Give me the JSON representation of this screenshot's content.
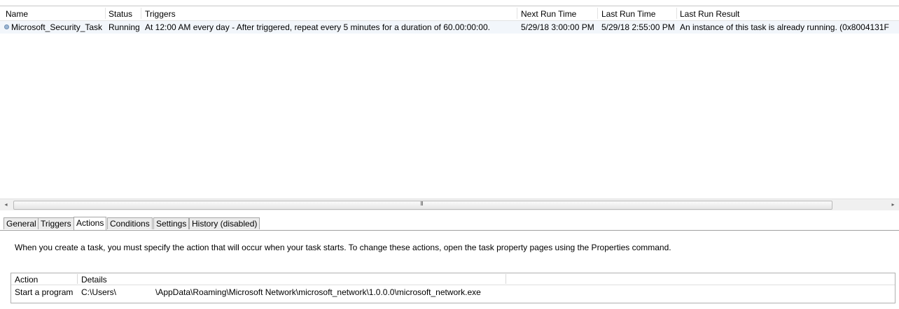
{
  "task_list": {
    "columns": [
      "Name",
      "Status",
      "Triggers",
      "Next Run Time",
      "Last Run Time",
      "Last Run Result"
    ],
    "rows": [
      {
        "name": "Microsoft_Security_Task",
        "status": "Running",
        "triggers": "At 12:00 AM every day - After triggered, repeat every 5 minutes for a duration of 60.00:00:00.",
        "next_run_time": "5/29/18 3:00:00 PM",
        "last_run_time": "5/29/18 2:55:00 PM",
        "last_run_result": "An instance of this task is already running. (0x8004131F"
      }
    ]
  },
  "scrollbar": {
    "left_arrow": "◂",
    "right_arrow": "▸",
    "grip": "III"
  },
  "tabs": [
    {
      "label": "General",
      "active": false
    },
    {
      "label": "Triggers",
      "active": false
    },
    {
      "label": "Actions",
      "active": true
    },
    {
      "label": "Conditions",
      "active": false
    },
    {
      "label": "Settings",
      "active": false
    },
    {
      "label": "History (disabled)",
      "active": false
    }
  ],
  "actions_pane": {
    "description": "When you create a task, you must specify the action that will occur when your task starts.  To change these actions, open the task property pages using the Properties command.",
    "columns": [
      "Action",
      "Details"
    ],
    "rows": [
      {
        "action": "Start a program",
        "details_prefix": "C:\\Users\\",
        "details_suffix": "\\AppData\\Roaming\\Microsoft Network\\microsoft_network\\1.0.0.0\\microsoft_network.exe"
      }
    ]
  },
  "colors": {
    "selected_row_bg": "#f2f6fb",
    "active_tab_bg": "#ffffff",
    "inactive_tab_bg": "#ececec"
  }
}
